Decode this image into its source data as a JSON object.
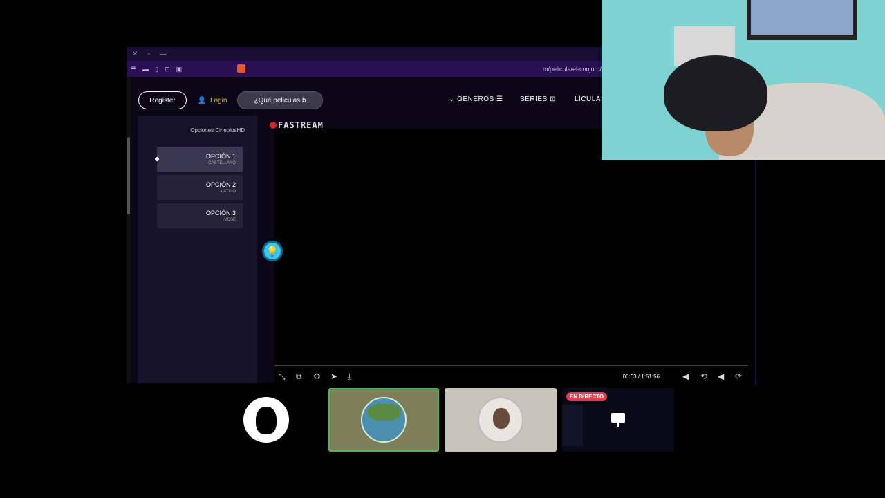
{
  "browser": {
    "url": "m/pelicula/el-conjuro/",
    "title_controls": [
      "—",
      "▫",
      "✕"
    ]
  },
  "navbar": {
    "register": "Register",
    "login": "Login",
    "search": "¿Qué peliculas b",
    "generos": "GENEROS",
    "series": "SERIES",
    "peliculas": "LÍCULAS"
  },
  "brand": "FASTREAM",
  "options": {
    "title": "Opciones CineplusHD",
    "items": [
      {
        "label": "OPCIÓN 1",
        "sub": "-CASTELLANO"
      },
      {
        "label": "OPCIÓN 2",
        "sub": "-LATINO"
      },
      {
        "label": "OPCIÓN 3",
        "sub": "-VOSE"
      }
    ]
  },
  "player": {
    "time": "00:03 / 1:51:56"
  },
  "participants": {
    "live_badge": "EN DIRECTO"
  }
}
